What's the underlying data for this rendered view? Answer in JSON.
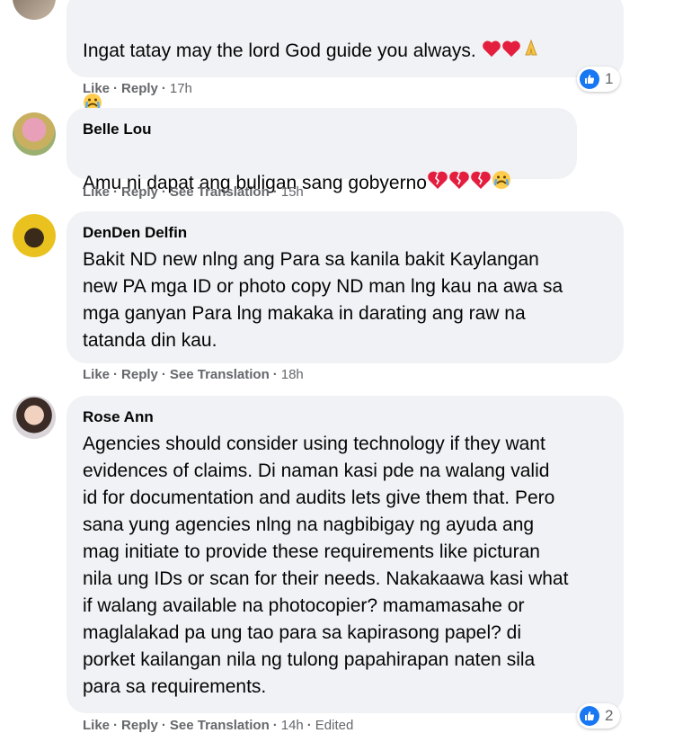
{
  "colors": {
    "bubble": "#f0f2f5",
    "meta": "#65676b",
    "like_blue": "#1877f2",
    "heart": "#e41e3f"
  },
  "comments": [
    {
      "author": "",
      "text": "Ingat tatay may the lord God guide you always. ",
      "emoji_suffix": [
        "red-heart",
        "red-heart",
        "folded-hands"
      ],
      "second_line_emoji": [
        "crying-face"
      ],
      "actions": {
        "like": "Like",
        "reply": "Reply",
        "time": "17h"
      },
      "reactions": {
        "icon": "like-icon",
        "count": "1"
      }
    },
    {
      "author": "Belle Lou",
      "text": "Amu ni dapat ang buligan sang gobyerno",
      "emoji_suffix": [
        "broken-heart",
        "broken-heart",
        "broken-heart",
        "crying-face"
      ],
      "actions": {
        "like": "Like",
        "reply": "Reply",
        "translate": "See Translation",
        "time": "15h"
      }
    },
    {
      "author": "DenDen Delfin",
      "text": "Bakit ND new nlng ang Para sa kanila bakit Kaylangan\nnew PA mga ID or photo copy ND man lng kau na awa sa\nmga ganyan Para lng makaka in darating ang raw na\ntatanda din kau.",
      "actions": {
        "like": "Like",
        "reply": "Reply",
        "translate": "See Translation",
        "time": "18h"
      }
    },
    {
      "author": "Rose Ann",
      "text": "Agencies should consider using technology if they want\nevidences of claims. Di naman kasi pde na walang valid\nid for documentation and audits lets give them that. Pero\nsana yung agencies nlng na nagbibigay ng ayuda ang\nmag initiate to provide these requirements like picturan\nnila ung IDs or scan for their needs. Nakakaawa kasi what\nif walang available na photocopier? mamamasahe or\nmaglalakad pa ung tao para sa kapirasong papel? di\nporket kailangan nila ng tulong papahirapan naten sila\npara sa requirements.",
      "actions": {
        "like": "Like",
        "reply": "Reply",
        "translate": "See Translation",
        "time": "14h",
        "edited": "Edited"
      },
      "reactions": {
        "icon": "like-icon",
        "count": "2"
      }
    }
  ],
  "separator": "·"
}
